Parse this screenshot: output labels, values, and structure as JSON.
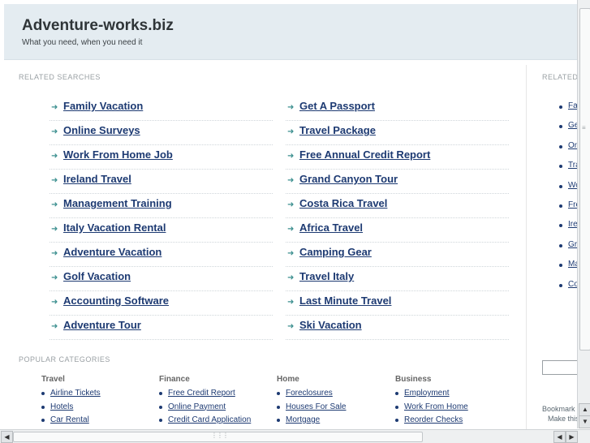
{
  "header": {
    "title": "Adventure-works.biz",
    "tagline": "What you need, when you need it"
  },
  "related_searches": {
    "title": "RELATED SEARCHES",
    "left": [
      "Family Vacation",
      "Online Surveys",
      "Work From Home Job",
      "Ireland Travel",
      "Management Training",
      "Italy Vacation Rental",
      "Adventure Vacation",
      "Golf Vacation",
      "Accounting Software",
      "Adventure Tour"
    ],
    "right": [
      "Get A Passport",
      "Travel Package",
      "Free Annual Credit Report",
      "Grand Canyon Tour",
      "Costa Rica Travel",
      "Africa Travel",
      "Camping Gear",
      "Travel Italy",
      "Last Minute Travel",
      "Ski Vacation"
    ]
  },
  "popular_categories": {
    "title": "POPULAR CATEGORIES",
    "columns": [
      {
        "heading": "Travel",
        "items": [
          "Airline Tickets",
          "Hotels",
          "Car Rental"
        ]
      },
      {
        "heading": "Finance",
        "items": [
          "Free Credit Report",
          "Online Payment",
          "Credit Card Application"
        ]
      },
      {
        "heading": "Home",
        "items": [
          "Foreclosures",
          "Houses For Sale",
          "Mortgage"
        ]
      },
      {
        "heading": "Business",
        "items": [
          "Employment",
          "Work From Home",
          "Reorder Checks"
        ]
      }
    ]
  },
  "right_panel": {
    "title": "RELATED",
    "items": [
      "Fa",
      "Ge",
      "On",
      "Tra",
      "Wo",
      "Fre",
      "Ire",
      "Gr",
      "Ma",
      "Co"
    ],
    "bookmark_line1": "Bookmark",
    "bookmark_line2": "Make this"
  },
  "colors": {
    "link": "#1d3a72",
    "arrow": "#3b8f8f",
    "header_bg": "#e4ecf1"
  },
  "icons": {
    "row_arrow": "arrow-right-icon",
    "bullet": "bullet-dot-icon"
  }
}
